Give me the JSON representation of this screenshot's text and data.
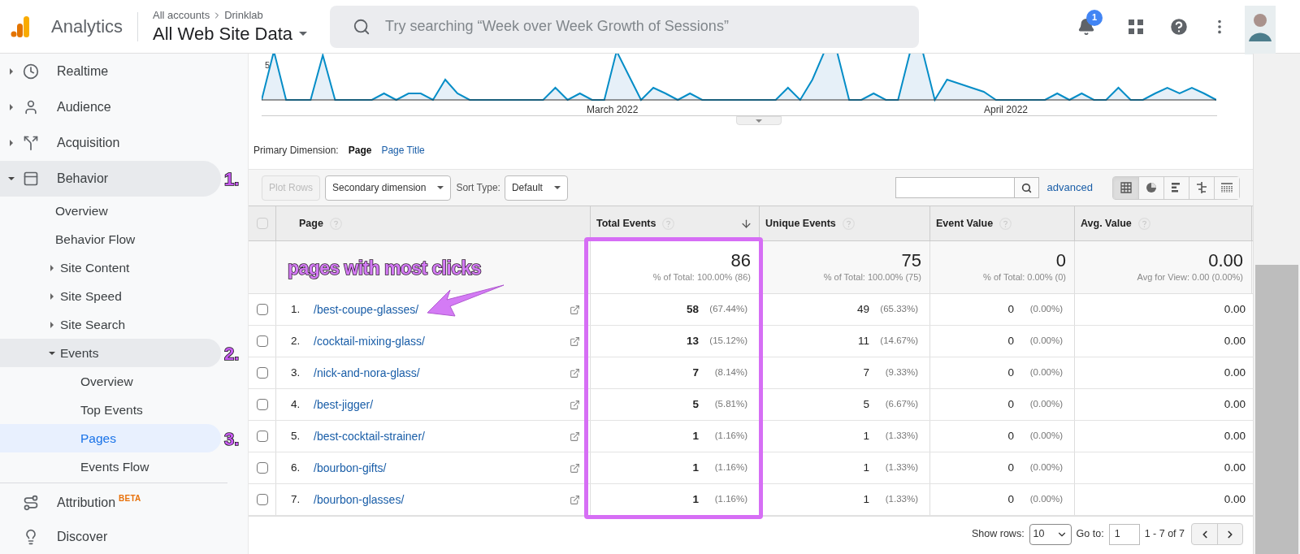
{
  "header": {
    "product": "Analytics",
    "breadcrumb": [
      "All accounts",
      "Drinklab"
    ],
    "property": "All Web Site Data",
    "search_placeholder": "Try searching “Week over Week Growth of Sessions”",
    "notification_count": "1"
  },
  "sidebar": {
    "items": [
      {
        "label": "Realtime",
        "kind": "clock",
        "expanded": false
      },
      {
        "label": "Audience",
        "kind": "person",
        "expanded": false
      },
      {
        "label": "Acquisition",
        "kind": "fork",
        "expanded": false
      },
      {
        "label": "Behavior",
        "kind": "window",
        "expanded": true,
        "annotation": "1.",
        "children": [
          {
            "label": "Overview",
            "selected": false
          },
          {
            "label": "Behavior Flow",
            "selected": false
          },
          {
            "label": "Site Content",
            "expanded": false
          },
          {
            "label": "Site Speed",
            "expanded": false
          },
          {
            "label": "Site Search",
            "expanded": false
          },
          {
            "label": "Events",
            "expanded": true,
            "annotation": "2.",
            "children": [
              {
                "label": "Overview",
                "selected": false
              },
              {
                "label": "Top Events",
                "selected": false
              },
              {
                "label": "Pages",
                "selected": true,
                "annotation": "3."
              },
              {
                "label": "Events Flow",
                "selected": false
              }
            ]
          }
        ]
      },
      {
        "label": "Attribution",
        "kind": "route",
        "badge": "BETA"
      },
      {
        "label": "Discover",
        "kind": "bulb"
      }
    ]
  },
  "chart": {
    "y_tick": "5",
    "x_labels": [
      "March 2022",
      "April 2022"
    ]
  },
  "primary_dimension": {
    "label": "Primary Dimension:",
    "options": [
      {
        "label": "Page",
        "selected": true
      },
      {
        "label": "Page Title",
        "selected": false
      }
    ]
  },
  "toolbar": {
    "plot_rows": {
      "label": "Plot Rows",
      "disabled": true
    },
    "secondary_dimension": "Secondary dimension",
    "sort_type_label": "Sort Type:",
    "sort_type": "Default",
    "advanced": "advanced",
    "views": [
      {
        "kind": "table",
        "selected": true
      },
      {
        "kind": "pie",
        "selected": false
      },
      {
        "kind": "bars",
        "selected": false
      },
      {
        "kind": "compare",
        "selected": false
      },
      {
        "kind": "pivot",
        "selected": false
      }
    ]
  },
  "table": {
    "select_all": {
      "checked": false
    },
    "columns": [
      {
        "label": "Page",
        "sorted": false,
        "highlighted": false
      },
      {
        "label": "Total Events",
        "sorted": true,
        "highlighted": true
      },
      {
        "label": "Unique Events",
        "sorted": false,
        "highlighted": false
      },
      {
        "label": "Event Value",
        "sorted": false,
        "highlighted": false
      },
      {
        "label": "Avg. Value",
        "sorted": false,
        "highlighted": false
      }
    ],
    "callout": "pages with most clicks",
    "totals": [
      {
        "value": "86",
        "detail": "% of Total: 100.00% (86)"
      },
      {
        "value": "75",
        "detail": "% of Total: 100.00% (75)"
      },
      {
        "value": "0",
        "detail": "% of Total: 0.00% (0)"
      },
      {
        "value": "0.00",
        "detail": "Avg for View: 0.00 (0.00%)"
      }
    ],
    "rows": [
      {
        "index": "1.",
        "page": "/best-coupe-glasses/",
        "checked": false,
        "total_events": [
          "58",
          "(67.44%)"
        ],
        "unique_events": [
          "49",
          "(65.33%)"
        ],
        "event_value": [
          "0",
          "(0.00%)"
        ],
        "avg_value": "0.00"
      },
      {
        "index": "2.",
        "page": "/cocktail-mixing-glass/",
        "checked": false,
        "total_events": [
          "13",
          "(15.12%)"
        ],
        "unique_events": [
          "11",
          "(14.67%)"
        ],
        "event_value": [
          "0",
          "(0.00%)"
        ],
        "avg_value": "0.00"
      },
      {
        "index": "3.",
        "page": "/nick-and-nora-glass/",
        "checked": false,
        "total_events": [
          "7",
          "(8.14%)"
        ],
        "unique_events": [
          "7",
          "(9.33%)"
        ],
        "event_value": [
          "0",
          "(0.00%)"
        ],
        "avg_value": "0.00"
      },
      {
        "index": "4.",
        "page": "/best-jigger/",
        "checked": false,
        "total_events": [
          "5",
          "(5.81%)"
        ],
        "unique_events": [
          "5",
          "(6.67%)"
        ],
        "event_value": [
          "0",
          "(0.00%)"
        ],
        "avg_value": "0.00"
      },
      {
        "index": "5.",
        "page": "/best-cocktail-strainer/",
        "checked": false,
        "total_events": [
          "1",
          "(1.16%)"
        ],
        "unique_events": [
          "1",
          "(1.33%)"
        ],
        "event_value": [
          "0",
          "(0.00%)"
        ],
        "avg_value": "0.00"
      },
      {
        "index": "6.",
        "page": "/bourbon-gifts/",
        "checked": false,
        "total_events": [
          "1",
          "(1.16%)"
        ],
        "unique_events": [
          "1",
          "(1.33%)"
        ],
        "event_value": [
          "0",
          "(0.00%)"
        ],
        "avg_value": "0.00"
      },
      {
        "index": "7.",
        "page": "/bourbon-glasses/",
        "checked": false,
        "total_events": [
          "1",
          "(1.16%)"
        ],
        "unique_events": [
          "1",
          "(1.33%)"
        ],
        "event_value": [
          "0",
          "(0.00%)"
        ],
        "avg_value": "0.00"
      }
    ]
  },
  "pagination": {
    "show_rows_label": "Show rows:",
    "show_rows": "10",
    "goto_label": "Go to:",
    "goto": "1",
    "range": "1 - 7 of 7"
  }
}
